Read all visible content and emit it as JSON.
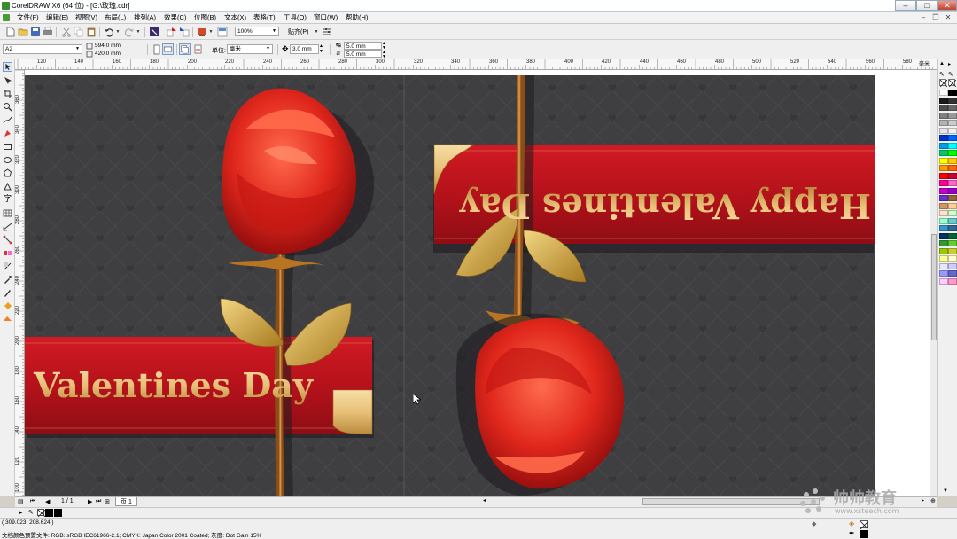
{
  "window": {
    "title": "CorelDRAW X6 (64 位) - [G:\\玫瑰.cdr]",
    "controls": [
      "–",
      "□",
      "✕"
    ]
  },
  "menu": [
    "文件(F)",
    "编辑(E)",
    "视图(V)",
    "布局(L)",
    "排列(A)",
    "效果(C)",
    "位图(B)",
    "文本(X)",
    "表格(T)",
    "工具(O)",
    "窗口(W)",
    "帮助(H)"
  ],
  "toolbar": {
    "zoom": "100%",
    "snap_label": "贴齐(P)",
    "icons": [
      "new-icon",
      "open-icon",
      "save-icon",
      "print-icon",
      "cut-icon",
      "copy-icon",
      "paste-icon",
      "undo-icon",
      "redo-icon",
      "import-icon",
      "export-icon",
      "app-launcher-icon",
      "options-icon"
    ]
  },
  "property_bar": {
    "paper": "A2",
    "width": "594.0 mm",
    "height": "420.0 mm",
    "unit_label": "单位:",
    "unit": "毫米",
    "nudge": "3.0 mm",
    "dup_x": "5.0 mm",
    "dup_y": "5.0 mm"
  },
  "rulers": {
    "top": [
      "120",
      "140",
      "160",
      "180",
      "200",
      "220",
      "240",
      "260",
      "280",
      "300",
      "320",
      "340",
      "360",
      "380",
      "400",
      "420",
      "440",
      "460",
      "480",
      "500",
      "520",
      "540",
      "560",
      "580",
      "毫米"
    ],
    "left": [
      "360",
      "340",
      "320",
      "300",
      "280",
      "260",
      "240",
      "220",
      "200",
      "180",
      "160",
      "140",
      "120",
      "100"
    ]
  },
  "artwork": {
    "text_left": "Valentines Day",
    "text_right": "Happy Valentines Day",
    "colors": {
      "background": "#3f3e41",
      "ribbon": "#b5121b",
      "gold": "#e8c078",
      "rose": "#e0271c",
      "stem": "#c57a2c",
      "leaf": "#c9a23a"
    }
  },
  "page_nav": {
    "counter": "1 / 1",
    "tab": "页 1"
  },
  "status": {
    "coords": "( 309.023, 208.624 )",
    "color_profile": "文档颜色预置文件: RGB: sRGB IEC61966-2.1; CMYK: Japan Color 2001 Coated; 灰度: Dot Gain 15%"
  },
  "watermark": {
    "brand": "帅帅教育",
    "url": "www.xsteech.com"
  },
  "palette": [
    "#ffffff",
    "#000000",
    "#1a1a1a",
    "#333333",
    "#4d4d4d",
    "#666666",
    "#808080",
    "#999999",
    "#b3b3b3",
    "#cccccc",
    "#e6e6e6",
    "#f2f2f2",
    "#0033cc",
    "#0066ff",
    "#00a0e9",
    "#00ffff",
    "#00cc66",
    "#00ff00",
    "#ffff00",
    "#ffcc00",
    "#ff9900",
    "#ff6600",
    "#ff0000",
    "#cc0033",
    "#ff0099",
    "#ff66cc",
    "#cc00cc",
    "#9900cc",
    "#6633cc",
    "#996633",
    "#cc9966",
    "#ffcc99",
    "#ffe5cc",
    "#ccffcc",
    "#99ffcc",
    "#66cccc",
    "#3399cc",
    "#336699",
    "#003366",
    "#006633",
    "#339933",
    "#66cc33",
    "#99cc00",
    "#cccc33",
    "#ffff99",
    "#ffffcc",
    "#e6e6ff",
    "#ccccff",
    "#9999ff",
    "#6666cc",
    "#ffccff",
    "#ff99cc"
  ]
}
